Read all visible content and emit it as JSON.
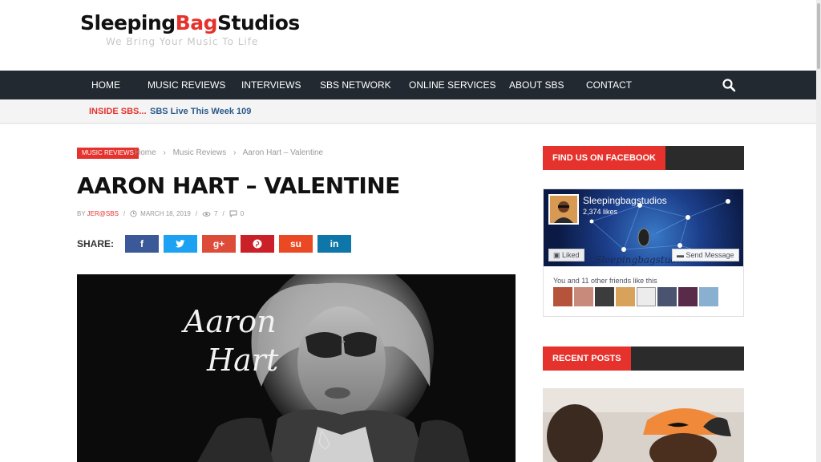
{
  "site": {
    "logo_part1": "Sleeping",
    "logo_part2": "Bag",
    "logo_part3": "Studios",
    "tagline": "We Bring Your Music To Life"
  },
  "nav": {
    "items": [
      "HOME",
      "MUSIC REVIEWS",
      "INTERVIEWS",
      "SBS NETWORK",
      "ONLINE SERVICES",
      "ABOUT SBS",
      "CONTACT"
    ],
    "search_icon": "search-icon"
  },
  "ticker": {
    "label": "INSIDE SBS...",
    "link": "SBS Live This Week 109"
  },
  "article": {
    "category_badge": "MUSIC REVIEWS",
    "breadcrumb": [
      "Home",
      "›",
      "Music Reviews",
      "›",
      "Aaron Hart – Valentine"
    ],
    "title": "AARON HART – VALENTINE",
    "by": "BY",
    "author": "JER@SBS",
    "date": "MARCH 18, 2019",
    "views": "7",
    "comments": "0",
    "share_label": "SHARE:",
    "share_buttons": [
      {
        "icon": "f",
        "name": "facebook",
        "color": "#3b5998"
      },
      {
        "icon": "t",
        "name": "twitter",
        "color": "#1da1f2"
      },
      {
        "icon": "g+",
        "name": "google-plus",
        "color": "#dd4b39"
      },
      {
        "icon": "p",
        "name": "pinterest",
        "color": "#cb2027"
      },
      {
        "icon": "su",
        "name": "stumbleupon",
        "color": "#eb4924"
      },
      {
        "icon": "in",
        "name": "linkedin",
        "color": "#0e76a8"
      }
    ],
    "image_script_text_line1": "Aaron",
    "image_script_text_line2": "Hart"
  },
  "sidebar": {
    "facebook_heading": "FIND US ON FACEBOOK",
    "fb_page_name": "Sleepingbagstudios",
    "fb_likes": "2,374 likes",
    "fb_liked_button": "Liked",
    "fb_send_button": "Send Message",
    "fb_friends_text": "You and 11 other friends like this",
    "recent_heading": "RECENT POSTS"
  },
  "colors": {
    "brand_red": "#e5322d",
    "nav_bg": "#222930"
  }
}
